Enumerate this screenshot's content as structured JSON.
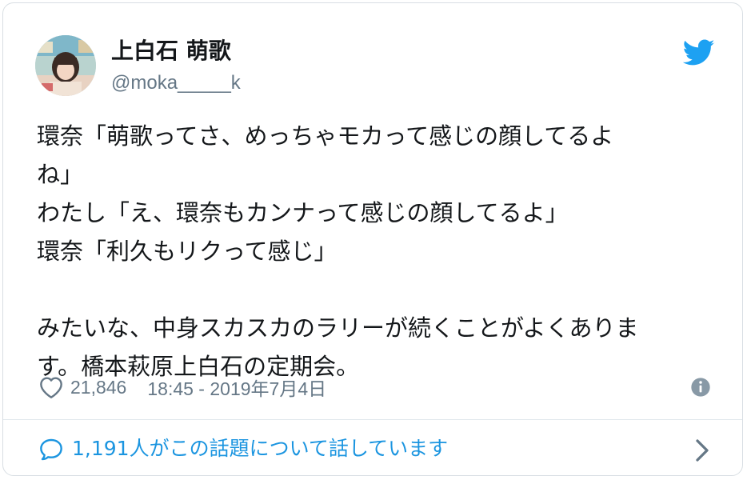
{
  "user": {
    "display_name": "上白石 萌歌",
    "handle": "@moka_____k"
  },
  "tweet": {
    "lines": [
      "環奈「萌歌ってさ、めっちゃモカって感じの顔してるよ",
      "ね」",
      "わたし「え、環奈もカンナって感じの顔してるよ」",
      "環奈「利久もリクって感じ」",
      "",
      "みたいな、中身スカスカのラリーが続くことがよくありま",
      "す。橋本萩原上白石の定期会。"
    ]
  },
  "meta": {
    "like_count": "21,846",
    "timestamp": "18:45 - 2019年7月4日"
  },
  "conversation": {
    "label": "1,191人がこの話題について話しています"
  },
  "icons": {
    "brand": "twitter-bird-icon",
    "like": "heart-icon",
    "info": "info-icon",
    "reply": "speech-bubble-icon",
    "more": "chevron-right-icon"
  },
  "colors": {
    "brand_blue": "#1da1f2",
    "link_blue": "#1b95e0",
    "secondary_text": "#657786",
    "primary_text": "#14171a",
    "border": "#e1e8ed"
  }
}
